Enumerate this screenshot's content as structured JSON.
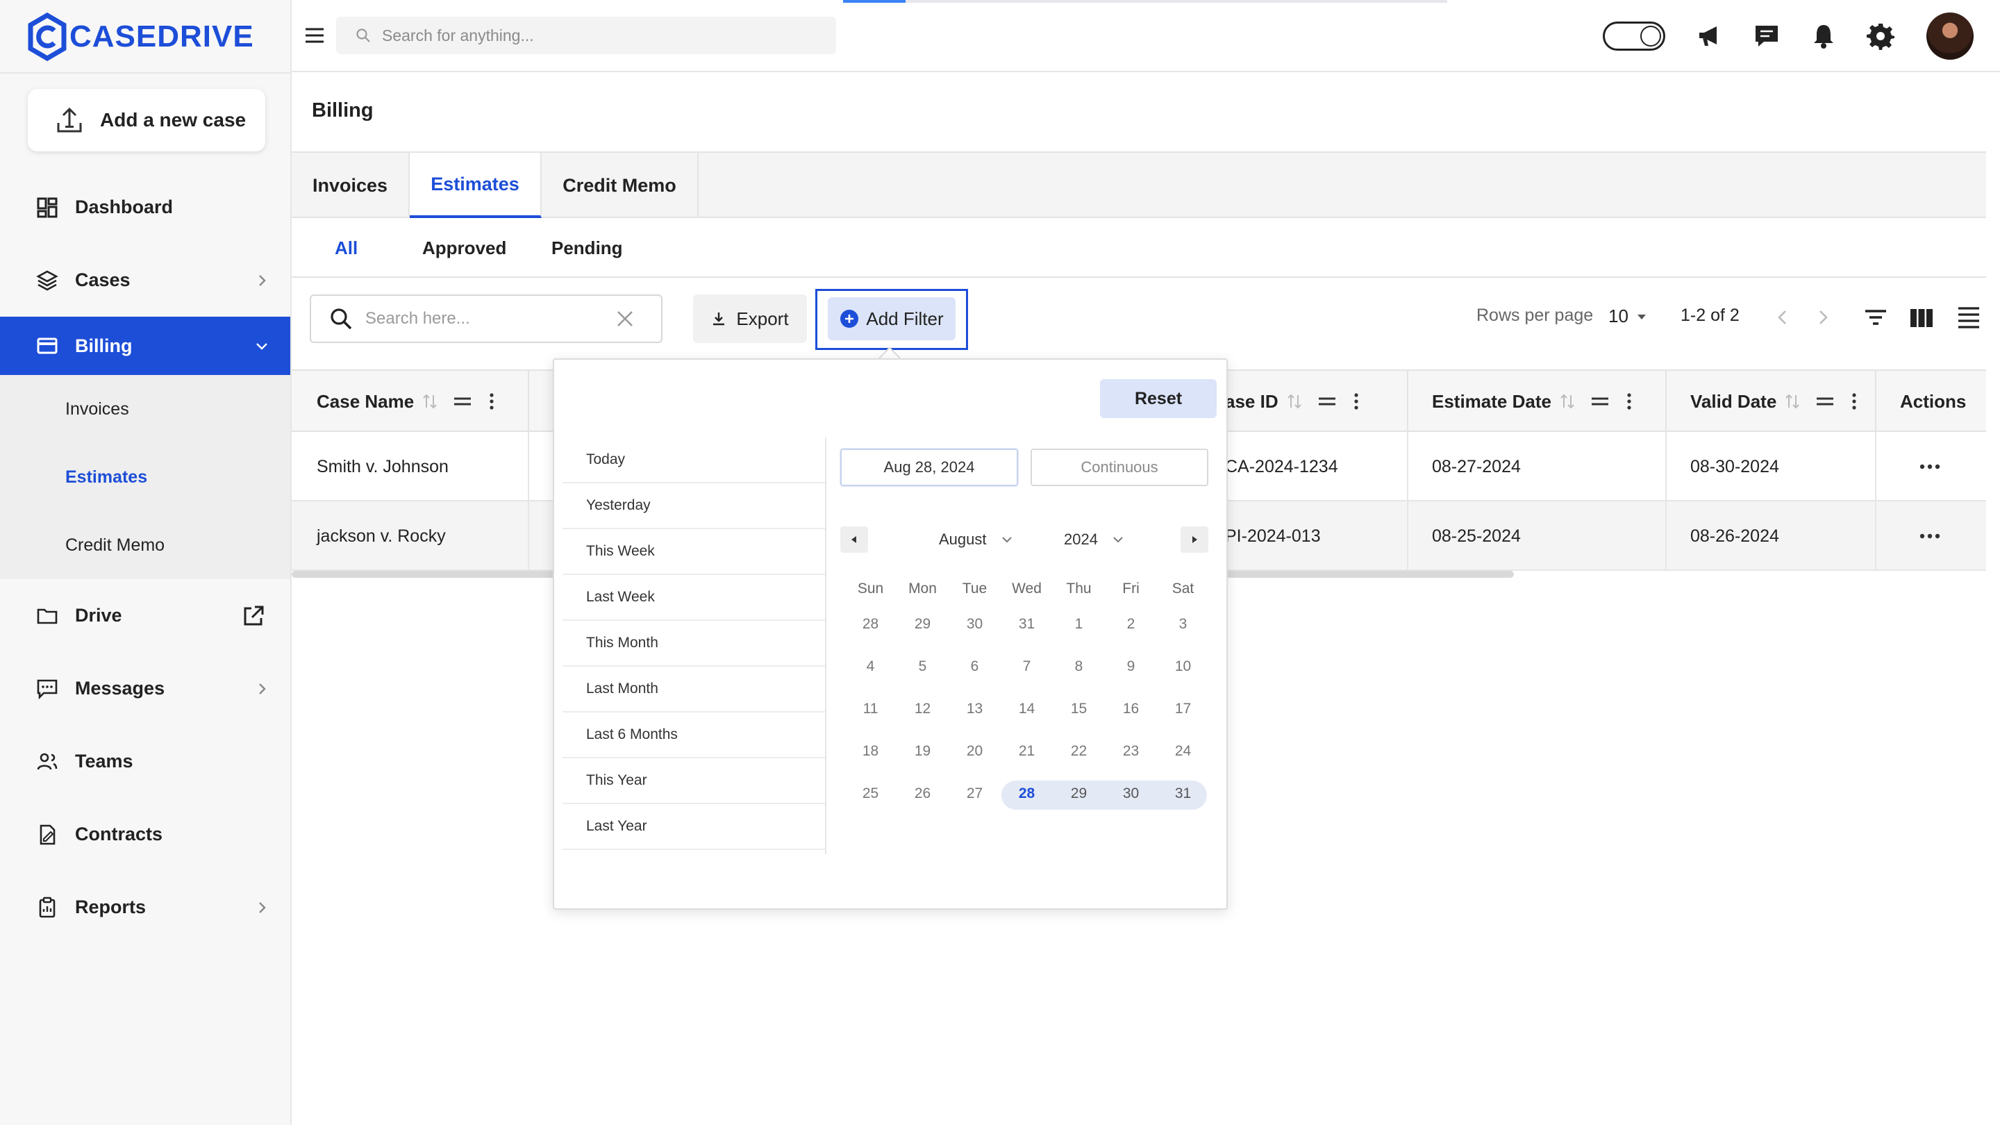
{
  "brand": {
    "name": "CASEDRIVE",
    "accent": "#1d4ed8"
  },
  "sidebar": {
    "new_case_label": "Add a new case",
    "items": [
      {
        "label": "Dashboard"
      },
      {
        "label": "Cases"
      },
      {
        "label": "Billing"
      },
      {
        "label": "Drive"
      },
      {
        "label": "Messages"
      },
      {
        "label": "Teams"
      },
      {
        "label": "Contracts"
      },
      {
        "label": "Reports"
      }
    ],
    "billing_sub": [
      {
        "label": "Invoices"
      },
      {
        "label": "Estimates"
      },
      {
        "label": "Credit Memo"
      }
    ]
  },
  "topbar": {
    "search_placeholder": "Search for anything...",
    "icons": [
      "theme-toggle-icon",
      "megaphone-icon",
      "chat-icon",
      "bell-icon",
      "gear-icon",
      "avatar"
    ]
  },
  "page": {
    "title": "Billing",
    "tabs": [
      {
        "label": "Invoices"
      },
      {
        "label": "Estimates"
      },
      {
        "label": "Credit Memo"
      }
    ],
    "subtabs": [
      {
        "label": "All"
      },
      {
        "label": "Approved"
      },
      {
        "label": "Pending"
      }
    ]
  },
  "toolbar": {
    "search_placeholder": "Search here...",
    "export_label": "Export",
    "add_filter_label": "Add Filter",
    "rows_per_page_label": "Rows per page",
    "rows_per_page_value": "10",
    "range_label": "1-2 of 2"
  },
  "table": {
    "columns": [
      {
        "label": "Case Name"
      },
      {
        "label": "ase ID"
      },
      {
        "label": "Estimate Date"
      },
      {
        "label": "Valid Date"
      },
      {
        "label": "Actions"
      }
    ],
    "rows": [
      {
        "case_name": "Smith v. Johnson",
        "case_id": "CA-2024-1234",
        "estimate_date": "08-27-2024",
        "valid_date": "08-30-2024"
      },
      {
        "case_name": "jackson v. Rocky",
        "case_id": "PI-2024-013",
        "estimate_date": "08-25-2024",
        "valid_date": "08-26-2024"
      }
    ]
  },
  "date_filter": {
    "reset_label": "Reset",
    "presets": [
      "Today",
      "Yesterday",
      "This Week",
      "Last Week",
      "This Month",
      "Last Month",
      "Last 6 Months",
      "This Year",
      "Last Year"
    ],
    "start_date": "Aug 28, 2024",
    "end_placeholder": "Continuous",
    "month": "August",
    "year": "2024",
    "weekdays": [
      "Sun",
      "Mon",
      "Tue",
      "Wed",
      "Thu",
      "Fri",
      "Sat"
    ],
    "weeks": [
      [
        "28",
        "29",
        "30",
        "31",
        "1",
        "2",
        "3"
      ],
      [
        "4",
        "5",
        "6",
        "7",
        "8",
        "9",
        "10"
      ],
      [
        "11",
        "12",
        "13",
        "14",
        "15",
        "16",
        "17"
      ],
      [
        "18",
        "19",
        "20",
        "21",
        "22",
        "23",
        "24"
      ],
      [
        "25",
        "26",
        "27",
        "28",
        "29",
        "30",
        "31"
      ]
    ],
    "selected_day": "28"
  }
}
